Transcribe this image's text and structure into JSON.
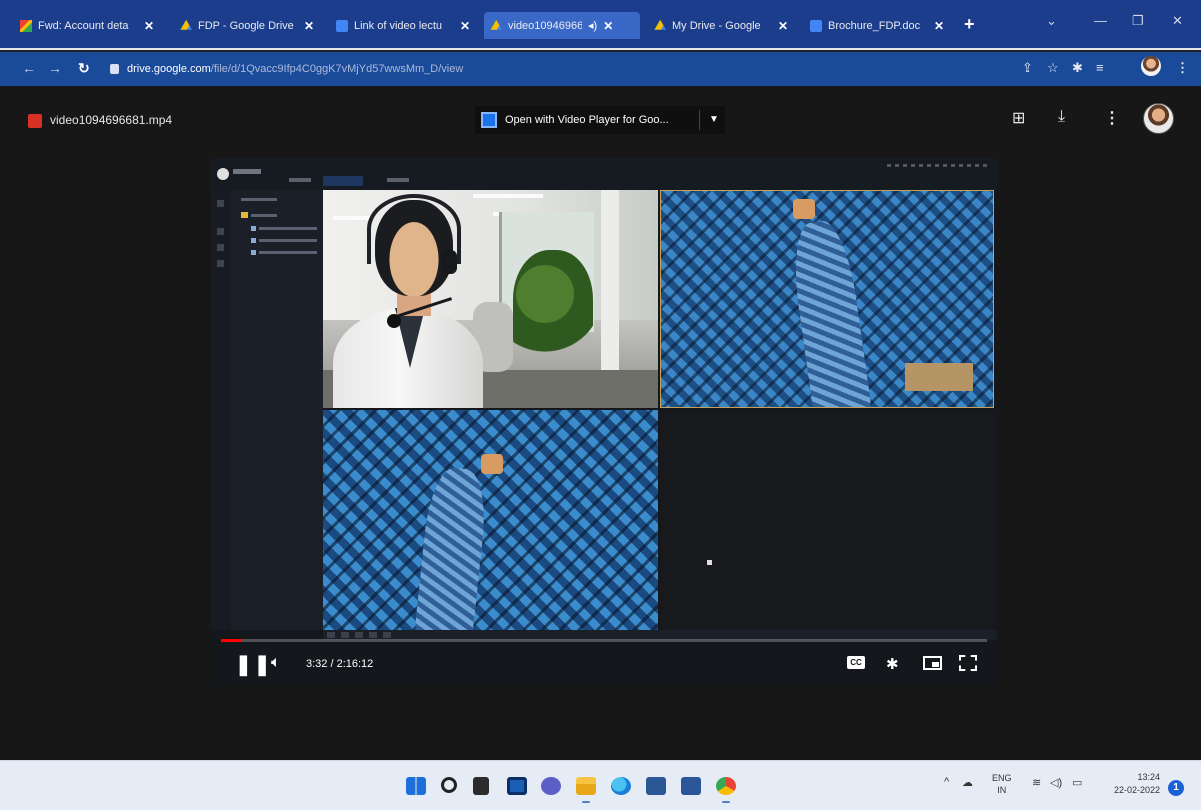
{
  "browser": {
    "tabs": [
      {
        "label": "Fwd: Account deta",
        "favicon": "gmail-icon",
        "color": "#ea4335"
      },
      {
        "label": "FDP - Google Drive",
        "favicon": "google-drive-icon",
        "color": "#fbbc04"
      },
      {
        "label": "Link of video lectu",
        "favicon": "google-docs-icon",
        "color": "#4285f4"
      },
      {
        "label": "video10946966",
        "favicon": "google-drive-icon",
        "color": "#fbbc04",
        "active": true
      },
      {
        "label": "My Drive - Google",
        "favicon": "google-drive-icon",
        "color": "#fbbc04"
      },
      {
        "label": "Brochure_FDP.doc",
        "favicon": "google-docs-icon",
        "color": "#4285f4"
      }
    ],
    "new_tab": "+",
    "address": {
      "domain": "drive.google.com",
      "path": "/file/d/1Qvacc9Ifp4C0ggK7vMjYd57wwsMm_D/view"
    }
  },
  "drive_viewer": {
    "file_name": "video1094696681.mp4",
    "open_with_label": "Open with Video Player for Goo...",
    "actions": [
      "add-comment-icon",
      "download-icon",
      "more-vert-icon"
    ]
  },
  "video_player": {
    "time": "3:32 / 2:16:12",
    "progress": 0.026,
    "cc_label": "CC"
  },
  "taskbar": {
    "apps": [
      "windows-start-icon",
      "search-icon",
      "file-explorer-icon",
      "task-view-icon",
      "teams-chat-icon",
      "folder-icon",
      "edge-icon",
      "store-icon",
      "word-icon",
      "chrome-icon"
    ],
    "language": "ENG",
    "region": "IN",
    "time": "13:24",
    "date": "22-02-2022",
    "notifications": "1"
  },
  "colors": {
    "tab_bar": "#1c3d8c",
    "address_bar": "#1a4a9a",
    "viewer_bg": "#171717",
    "progress": "#ff0000"
  }
}
